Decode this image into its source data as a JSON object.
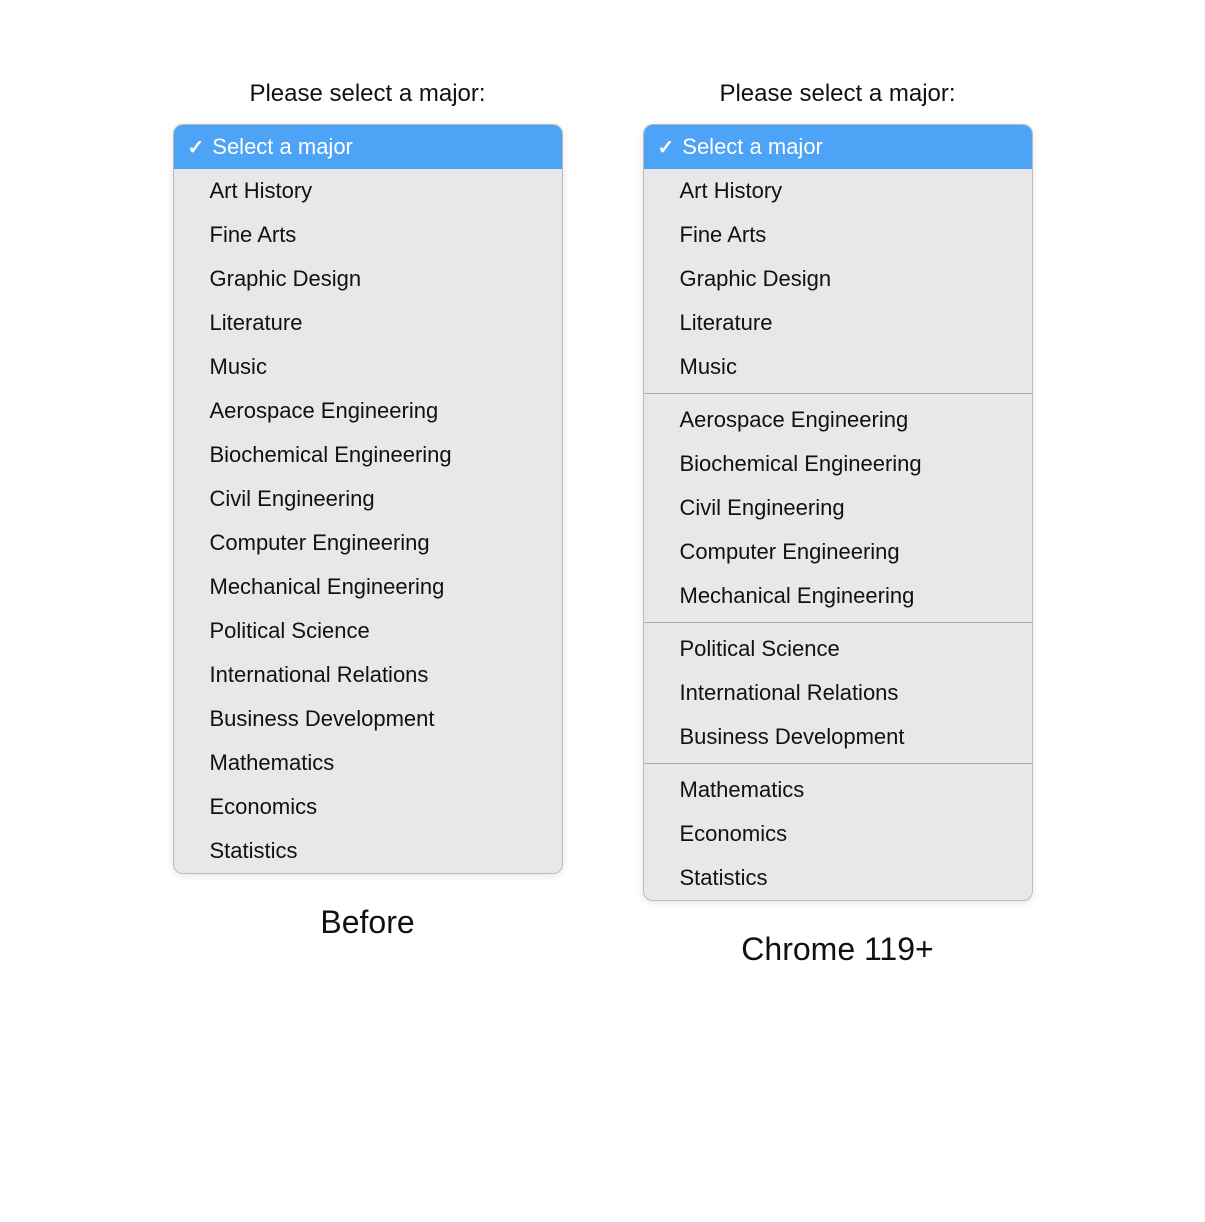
{
  "page": {
    "title_before": "Before",
    "title_after": "Chrome 119+",
    "label": "Please select a major:"
  },
  "select_placeholder": "Select a major",
  "options_before": [
    {
      "id": "select-a-major",
      "label": "Select a major",
      "selected": true
    },
    {
      "id": "art-history",
      "label": "Art History"
    },
    {
      "id": "fine-arts",
      "label": "Fine Arts"
    },
    {
      "id": "graphic-design",
      "label": "Graphic Design"
    },
    {
      "id": "literature",
      "label": "Literature"
    },
    {
      "id": "music",
      "label": "Music"
    },
    {
      "id": "aerospace-engineering",
      "label": "Aerospace Engineering"
    },
    {
      "id": "biochemical-engineering",
      "label": "Biochemical Engineering"
    },
    {
      "id": "civil-engineering",
      "label": "Civil Engineering"
    },
    {
      "id": "computer-engineering",
      "label": "Computer Engineering"
    },
    {
      "id": "mechanical-engineering",
      "label": "Mechanical Engineering"
    },
    {
      "id": "political-science",
      "label": "Political Science"
    },
    {
      "id": "international-relations",
      "label": "International Relations"
    },
    {
      "id": "business-development",
      "label": "Business Development"
    },
    {
      "id": "mathematics",
      "label": "Mathematics"
    },
    {
      "id": "economics",
      "label": "Economics"
    },
    {
      "id": "statistics",
      "label": "Statistics"
    }
  ],
  "groups_after": [
    {
      "id": "group-selected",
      "items": [
        {
          "id": "select-a-major",
          "label": "Select a major",
          "selected": true
        }
      ],
      "divider_after": false
    },
    {
      "id": "group-arts",
      "items": [
        {
          "id": "art-history",
          "label": "Art History"
        },
        {
          "id": "fine-arts",
          "label": "Fine Arts"
        },
        {
          "id": "graphic-design",
          "label": "Graphic Design"
        },
        {
          "id": "literature",
          "label": "Literature"
        },
        {
          "id": "music",
          "label": "Music"
        }
      ],
      "divider_after": true
    },
    {
      "id": "group-engineering",
      "items": [
        {
          "id": "aerospace-engineering",
          "label": "Aerospace Engineering"
        },
        {
          "id": "biochemical-engineering",
          "label": "Biochemical Engineering"
        },
        {
          "id": "civil-engineering",
          "label": "Civil Engineering"
        },
        {
          "id": "computer-engineering",
          "label": "Computer Engineering"
        },
        {
          "id": "mechanical-engineering",
          "label": "Mechanical Engineering"
        }
      ],
      "divider_after": true
    },
    {
      "id": "group-social",
      "items": [
        {
          "id": "political-science",
          "label": "Political Science"
        },
        {
          "id": "international-relations",
          "label": "International Relations"
        },
        {
          "id": "business-development",
          "label": "Business Development"
        }
      ],
      "divider_after": true
    },
    {
      "id": "group-math",
      "items": [
        {
          "id": "mathematics",
          "label": "Mathematics"
        },
        {
          "id": "economics",
          "label": "Economics"
        },
        {
          "id": "statistics",
          "label": "Statistics"
        }
      ],
      "divider_after": false
    }
  ]
}
